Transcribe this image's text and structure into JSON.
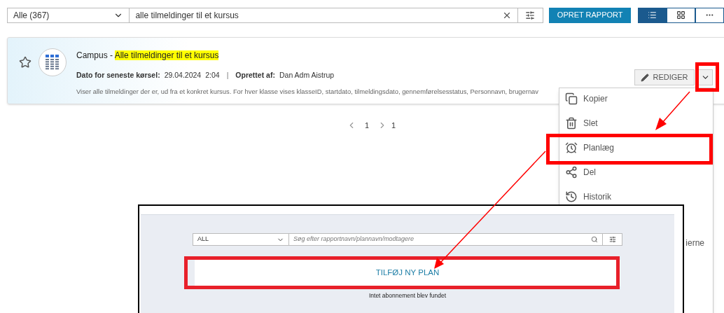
{
  "toolbar": {
    "category": "Alle (367)",
    "search": "alle tilmeldinger til et kursus",
    "create_button": "OPRET RAPPORT",
    "views": [
      {
        "kind": "list",
        "selected": true
      },
      {
        "kind": "grid",
        "selected": false
      },
      {
        "kind": "more",
        "selected": false
      }
    ]
  },
  "report": {
    "favorite": false,
    "title_prefix": "Campus - ",
    "title_match": "Alle tilmeldinger til et kursus",
    "last_run_label": "Dato for seneste kørsel:",
    "last_run_date": "29.04.2024",
    "last_run_time": "2:04",
    "separator": "|",
    "created_by_label": "Oprettet af:",
    "created_by": "Dan Adm Aistrup",
    "description": "Viser alle tilmeldinger der er, ud fra et konkret kursus. For hver klasse vises klasseID, startdato, tilmeldingsdato, gennemførelsesstatus, Personnavn, brugernav",
    "edit_button": "REDIGER"
  },
  "pagination": {
    "page": "1",
    "total": "1"
  },
  "menu": {
    "items": [
      {
        "kind": "copy",
        "label": "Kopier"
      },
      {
        "kind": "delete",
        "label": "Slet"
      },
      {
        "kind": "schedule",
        "label": "Planlæg"
      },
      {
        "kind": "share",
        "label": "Del"
      },
      {
        "kind": "history",
        "label": "Historik"
      }
    ],
    "partial_item": "ierne"
  },
  "inset": {
    "filter": "ALL",
    "search_placeholder": "Søg efter rapportnavn/plannavn/modtagere",
    "add_button": "TILFØJ NY PLAN",
    "empty_message": "Intet abonnement blev fundet"
  }
}
